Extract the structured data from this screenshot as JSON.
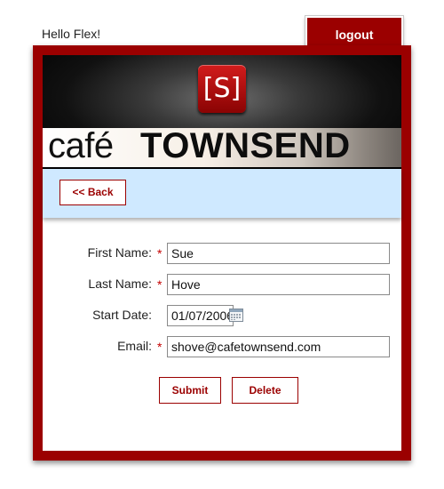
{
  "header": {
    "greeting": "Hello Flex!",
    "logout_label": "logout"
  },
  "banner": {
    "logo_text": "[S]",
    "brand_prefix": "café",
    "brand_name": "TOWNSEND"
  },
  "toolbar": {
    "back_label": "<< Back"
  },
  "form": {
    "first_name": {
      "label": "First Name:",
      "value": "Sue",
      "required": true
    },
    "last_name": {
      "label": "Last Name:",
      "value": "Hove",
      "required": true
    },
    "start_date": {
      "label": "Start Date:",
      "value": "01/07/2006",
      "required": false
    },
    "email": {
      "label": "Email:",
      "value": "shove@cafetownsend.com",
      "required": true
    },
    "required_marker": "*",
    "submit_label": "Submit",
    "delete_label": "Delete"
  },
  "colors": {
    "brand_red": "#9b0000",
    "toolbar_blue": "#cfe9ff",
    "required_red": "#c40000"
  },
  "icons": {
    "date_picker": "calendar-icon"
  }
}
